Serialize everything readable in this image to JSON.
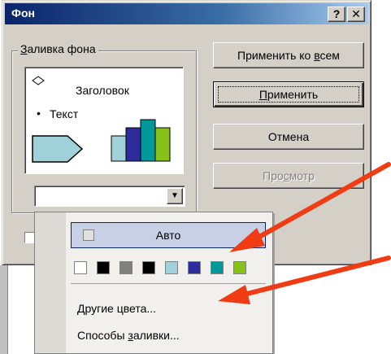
{
  "window": {
    "title": "Фон",
    "help_button": "?",
    "close_button": "✕"
  },
  "fill_group": {
    "label_underlined": "З",
    "label_rest": "аливка фона",
    "preview": {
      "heading": "Заголовок",
      "bullet": "•",
      "text": "Текст"
    },
    "combo_arrow": "▼"
  },
  "buttons": {
    "apply_all_pre": "Применить ко ",
    "apply_all_u": "в",
    "apply_all_post": "сем",
    "apply_u": "П",
    "apply_post": "рименить",
    "cancel": "Отмена",
    "preview_pre": "Про",
    "preview_u": "с",
    "preview_post": "мотр"
  },
  "menu": {
    "auto_label": "Авто",
    "more_colors_pre": "",
    "more_colors_u": "Д",
    "more_colors_post": "ругие цвета...",
    "fill_effects_pre": "Способы ",
    "fill_effects_u": "з",
    "fill_effects_post": "аливки...",
    "swatch_colors": [
      "#ffffff",
      "#000000",
      "#808080",
      "#000000",
      "#a0d0d8",
      "#2c2c9c",
      "#009999",
      "#86c21a"
    ]
  },
  "colors": {
    "arrow": "#f03c14",
    "titlebar": "#0a246a",
    "dialog_face": "#d4d0c8"
  }
}
